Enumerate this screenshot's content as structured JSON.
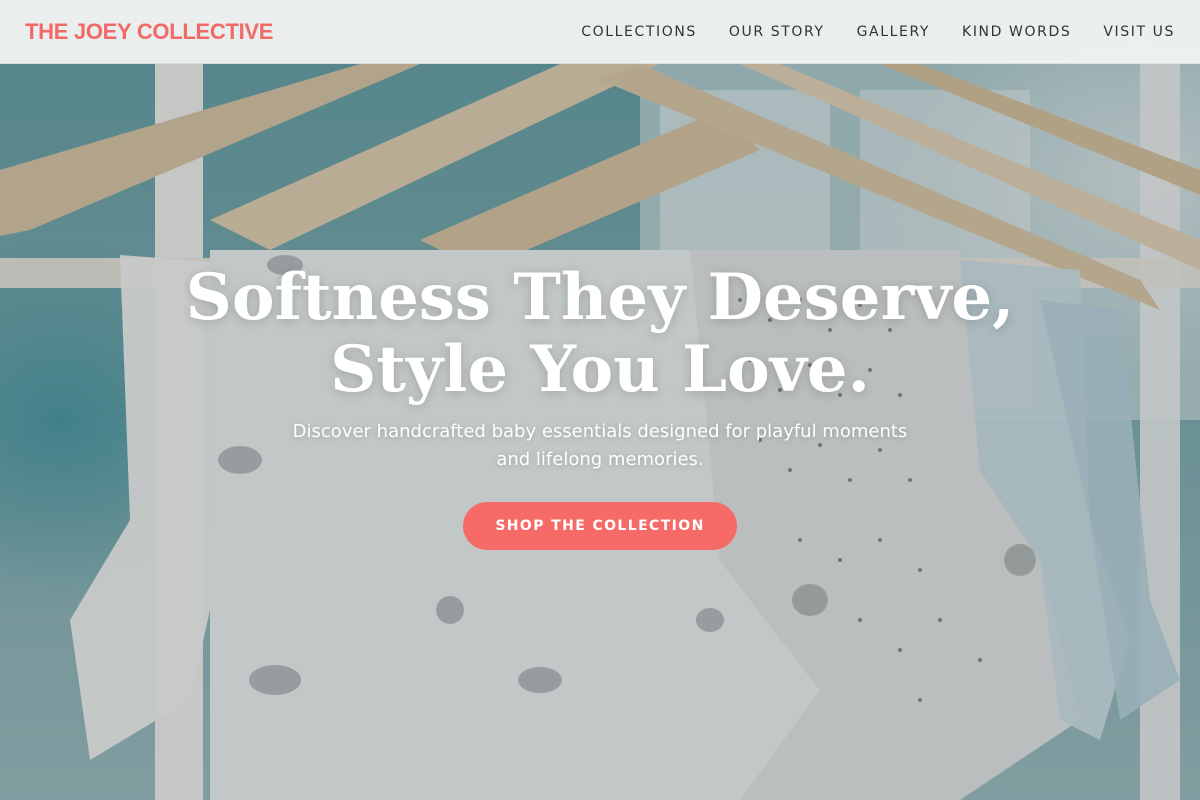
{
  "header": {
    "brand": "THE JOEY COLLECTIVE",
    "nav": [
      {
        "label": "COLLECTIONS"
      },
      {
        "label": "OUR STORY"
      },
      {
        "label": "GALLERY"
      },
      {
        "label": "KIND WORDS"
      },
      {
        "label": "VISIT US"
      }
    ]
  },
  "hero": {
    "title_line1": "Softness They Deserve,",
    "title_line2": "Style You Love.",
    "subtitle_line1": "Discover handcrafted baby essentials designed for playful moments",
    "subtitle_line2": "and lifelong memories.",
    "cta_label": "SHOP THE COLLECTION"
  },
  "colors": {
    "brand": "#f26a66",
    "cta": "#f66b67",
    "nav_text": "#333333"
  }
}
